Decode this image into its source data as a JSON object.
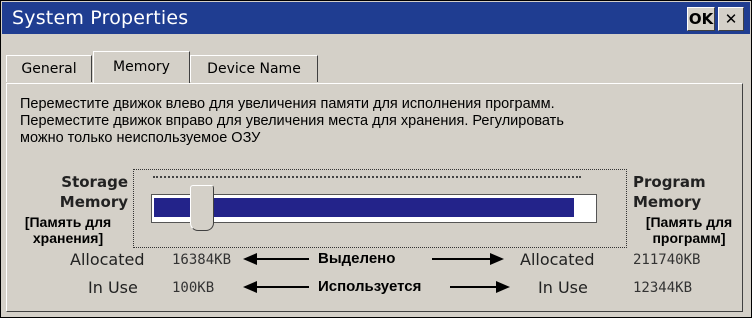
{
  "window": {
    "title": "System Properties",
    "ok_label": "OK",
    "close_label": "✕"
  },
  "tabs": [
    {
      "label": "General",
      "active": false
    },
    {
      "label": "Memory",
      "active": true
    },
    {
      "label": "Device Name",
      "active": false
    }
  ],
  "description": [
    "Переместите движок влево для увеличения памяти для исполнения программ.",
    "Переместите движок вправо для увеличения места для хранения. Регулировать",
    "можно только неиспользуемое ОЗУ"
  ],
  "storage": {
    "label_line1": "Storage",
    "label_line2": "Memory",
    "ru_line1": "[Память для",
    "ru_line2": "хранения]"
  },
  "program": {
    "label_line1": "Program",
    "label_line2": "Memory",
    "ru_line1": "[Память для",
    "ru_line2": "программ]"
  },
  "slider": {
    "position_fraction": 0.07,
    "fill_color": "#23238a"
  },
  "allocated": {
    "label_left": "Allocated",
    "value_left": "16384KB",
    "label_right": "Allocated",
    "value_right": "211740KB",
    "annotation": "Выделено"
  },
  "in_use": {
    "label_left": "In Use",
    "value_left": "100KB",
    "label_right": "In Use",
    "value_right": "12344KB",
    "annotation": "Используется"
  },
  "colors": {
    "titlebar": "#1f3d91",
    "face": "#d4d0c8"
  }
}
